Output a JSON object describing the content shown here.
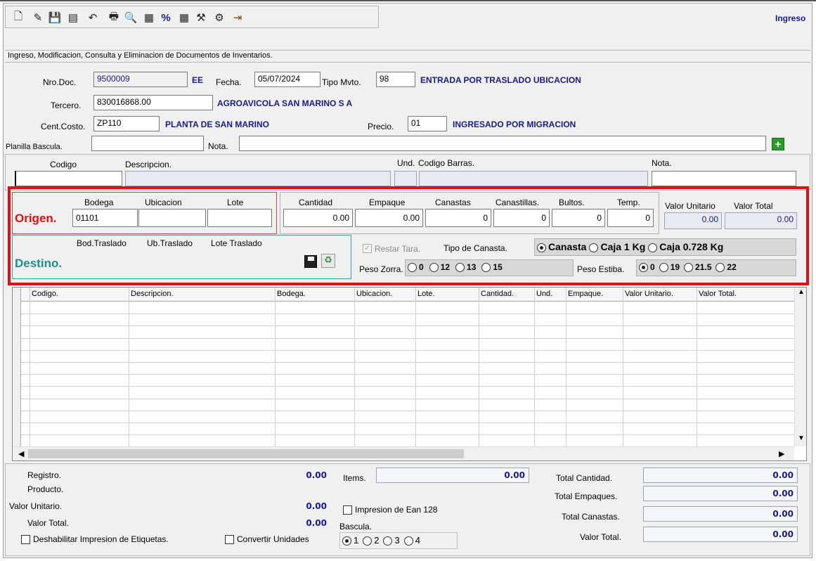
{
  "toolbar": {
    "icons": [
      "new-icon",
      "edit-icon",
      "save-icon",
      "copy-icon",
      "undo-icon",
      "print-icon",
      "preview-icon",
      "report-icon",
      "percent-icon",
      "calculator-icon",
      "tools-icon",
      "settings-icon",
      "exit-icon"
    ],
    "glyphs": [
      "🗋",
      "✎",
      "💾",
      "▤",
      "↶",
      "🖶",
      "🔍",
      "▦",
      "%",
      "▦",
      "⚒",
      "⚙",
      "⇥"
    ],
    "mode": "Ingreso"
  },
  "subtitle": "Ingreso, Modificacion, Consulta y Eliminacion de Documentos de Inventarios.",
  "header": {
    "nro_doc_label": "Nro.Doc.",
    "nro_doc": "9500009",
    "doc_type": "EE",
    "fecha_label": "Fecha.",
    "fecha": "05/07/2024",
    "tipo_mvto_label": "Tipo Mvto.",
    "tipo_mvto": "98",
    "tipo_mvto_desc": "ENTRADA POR TRASLADO UBICACION",
    "tercero_label": "Tercero.",
    "tercero": "830016868.00",
    "tercero_desc": "AGROAVICOLA SAN MARINO S A",
    "cent_costo_label": "Cent.Costo.",
    "cent_costo": "ZP110",
    "cent_costo_desc": "PLANTA DE SAN MARINO",
    "precio_label": "Precio.",
    "precio": "01",
    "precio_desc": "INGRESADO POR MIGRACION",
    "planilla_label": "Planilla Bascula.",
    "planilla": "",
    "nota_label": "Nota.",
    "nota": ""
  },
  "item_row": {
    "codigo": "Codigo",
    "descripcion": "Descripcion.",
    "und": "Und.",
    "codigo_barras": "Codigo Barras.",
    "nota": "Nota."
  },
  "origen": {
    "title": "Origen.",
    "bodega_label": "Bodega",
    "ubicacion_label": "Ubicacion",
    "lote_label": "Lote",
    "bodega": "01101",
    "ubicacion": "",
    "lote": ""
  },
  "quantities": {
    "cantidad_label": "Cantidad",
    "cantidad": "0.00",
    "empaque_label": "Empaque",
    "empaque": "0.00",
    "canastas_label": "Canastas",
    "canastas": "0",
    "canastillas_label": "Canastillas.",
    "canastillas": "0",
    "bultos_label": "Bultos.",
    "bultos": "0",
    "temp_label": "Temp.",
    "temp": "0",
    "valor_unitario_label": "Valor Unitario",
    "valor_unitario": "0.00",
    "valor_total_label": "Valor Total",
    "valor_total": "0.00"
  },
  "destino": {
    "title": "Destino.",
    "bod_label": "Bod.Traslado",
    "ub_label": "Ub.Traslado",
    "lote_label": "Lote Traslado"
  },
  "options": {
    "restar_tara": "Restar Tara.",
    "tipo_canasta_label": "Tipo de Canasta.",
    "tipo_canasta": [
      "Canasta",
      "Caja 1 Kg",
      "Caja 0.728 Kg"
    ],
    "peso_zorra_label": "Peso Zorra.",
    "peso_zorra": [
      "0",
      "12",
      "13",
      "15"
    ],
    "peso_estiba_label": "Peso Estiba.",
    "peso_estiba": [
      "0",
      "19",
      "21.5",
      "22"
    ]
  },
  "grid": {
    "columns": [
      "Codigo.",
      "Descripcion.",
      "Bodega.",
      "Ubicacion.",
      "Lote.",
      "Cantidad.",
      "Und.",
      "Empaque.",
      "Valor Unitario.",
      "Valor Total."
    ]
  },
  "footer": {
    "registro_label": "Registro.",
    "registro": "0.00",
    "producto_label": "Producto.",
    "valor_unitario_label": "Valor Unitario.",
    "valor_unitario": "0.00",
    "valor_total_label": "Valor Total.",
    "valor_total": "0.00",
    "deshabilitar_label": "Deshabilitar Impresion de Etiquetas.",
    "convertir_label": "Convertir Unidades",
    "items_label": "Items.",
    "items": "0.00",
    "ean_label": "Impresion de Ean 128",
    "bascula_label": "Bascula.",
    "bascula": [
      "1",
      "2",
      "3",
      "4"
    ],
    "total_cantidad_label": "Total Cantidad.",
    "total_cantidad": "0.00",
    "total_empaques_label": "Total Empaques.",
    "total_empaques": "0.00",
    "total_canastas_label": "Total Canastas.",
    "total_canastas": "0.00",
    "total_valor_label": "Valor Total.",
    "total_valor": "0.00"
  },
  "colors": {
    "highlight": "#e01010",
    "origen": "#e01010",
    "destino": "#1a9090",
    "label_blue": "#1a1a8c"
  }
}
